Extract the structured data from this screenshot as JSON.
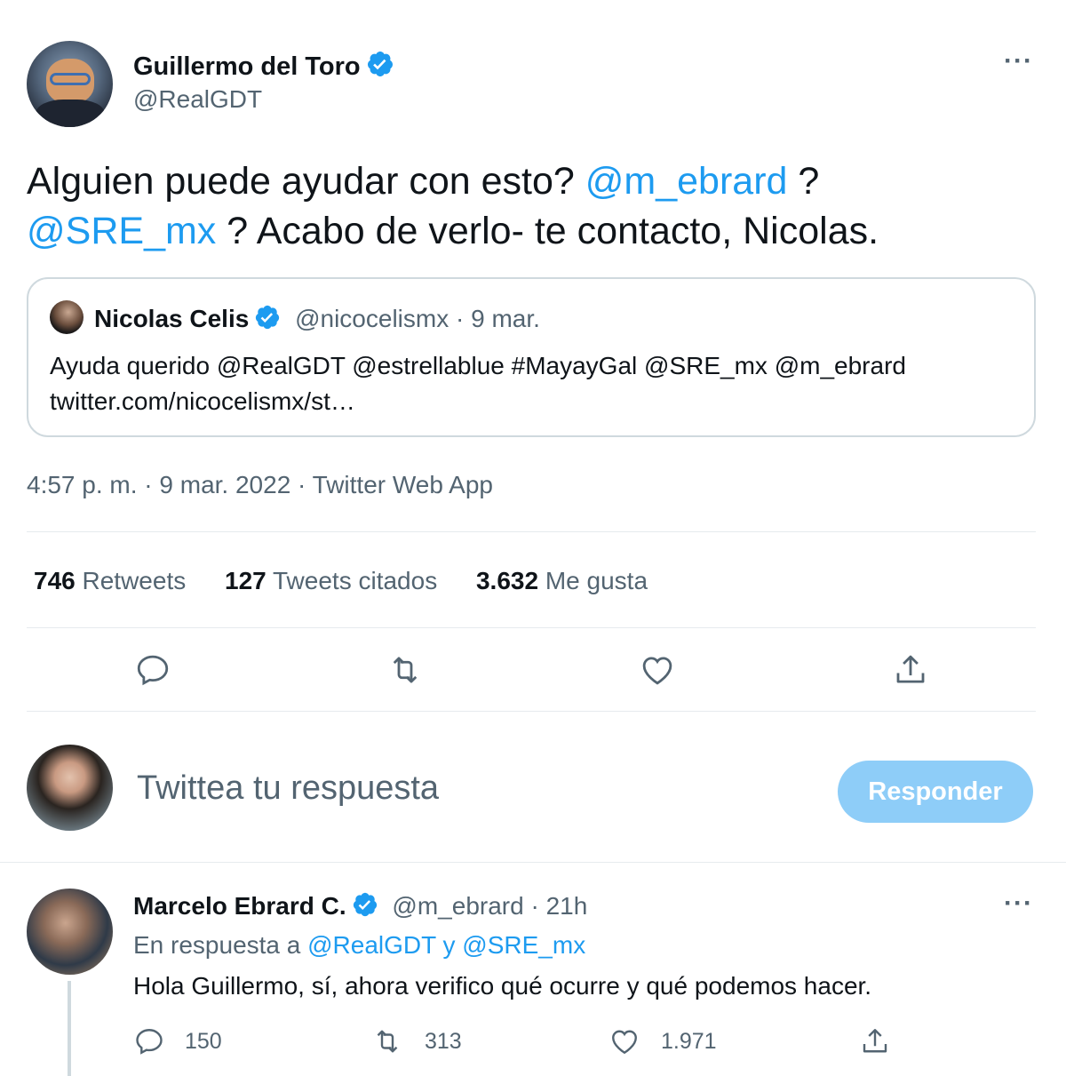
{
  "main_tweet": {
    "author_name": "Guillermo del Toro",
    "author_handle": "@RealGDT",
    "text_line1_a": "Alguien puede ayudar con esto? ",
    "mention1": "@m_ebrard",
    "text_line1_b": " ?",
    "mention2": "@SRE_mx",
    "text_line2": " ? Acabo de verlo- te contacto, Nicolas.",
    "timestamp": "4:57 p. m. · 9 mar. 2022 · Twitter Web App"
  },
  "quoted_tweet": {
    "author_name": "Nicolas Celis",
    "handle_date": "@nicocelismx · 9 mar.",
    "text_line1": "Ayuda querido @RealGDT @estrellablue #MayayGal @SRE_mx @m_ebrard",
    "text_line2": "twitter.com/nicocelismx/st…"
  },
  "stats": [
    {
      "value": "746",
      "label": "Retweets"
    },
    {
      "value": "127",
      "label": "Tweets citados"
    },
    {
      "value": "3.632",
      "label": "Me gusta"
    }
  ],
  "composer": {
    "placeholder": "Twittea tu respuesta",
    "button_label": "Responder"
  },
  "reply_tweet": {
    "author_name": "Marcelo Ebrard C.",
    "handle_time": "@m_ebrard · 21h",
    "context_prefix": "En respuesta a ",
    "context_mention1": "@RealGDT",
    "context_and": " y ",
    "context_mention2": "@SRE_mx",
    "text": "Hola Guillermo, sí, ahora verifico qué ocurre y qué podemos hacer.",
    "replies": "150",
    "retweets": "313",
    "likes": "1.971"
  },
  "icons": {
    "more": "more-dots-icon",
    "verified": "verified-badge-icon",
    "reply": "reply-icon",
    "retweet": "retweet-icon",
    "like": "heart-icon",
    "share": "share-icon"
  },
  "colors": {
    "link": "#1d9bf0",
    "muted": "#536471",
    "reply_button": "#8ecdf8"
  }
}
